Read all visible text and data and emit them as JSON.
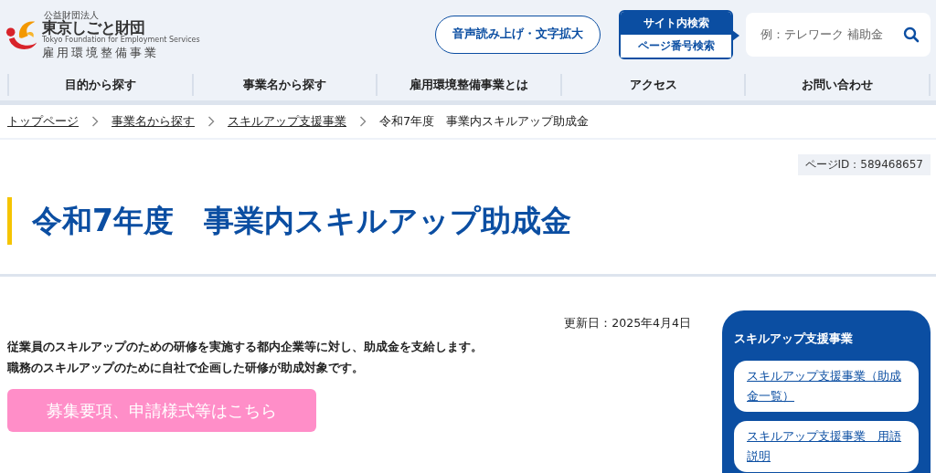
{
  "logo": {
    "org_type": "公益財団法人",
    "name": "東京しごと財団",
    "english": "Tokyo Foundation for Employment Services",
    "division": "雇用環境整備事業"
  },
  "accessibility_button": "音声読み上げ・文字拡大",
  "search_tabs": [
    {
      "label": "サイト内検索",
      "selected": true
    },
    {
      "label": "ページ番号検索",
      "selected": false
    }
  ],
  "search": {
    "placeholder": "例：テレワーク 補助金"
  },
  "nav": [
    "目的から探す",
    "事業名から探す",
    "雇用環境整備事業とは",
    "アクセス",
    "お問い合わせ"
  ],
  "breadcrumb": [
    {
      "label": "トップページ",
      "link": true
    },
    {
      "label": "事業名から探す",
      "link": true
    },
    {
      "label": "スキルアップ支援事業",
      "link": true
    },
    {
      "label": "令和7年度　事業内スキルアップ助成金",
      "link": false
    }
  ],
  "page_id": "ページID：589468657",
  "title": "令和7年度　事業内スキルアップ助成金",
  "updated": "更新日：2025年4月4日",
  "intro": [
    "従業員のスキルアップのための研修を実施する都内企業等に対し、助成金を支給します。",
    "職務のスキルアップのために自社で企画した研修が助成対象です。"
  ],
  "cta_button": "募集要項、申請様式等はこちら",
  "sidebar": {
    "title": "スキルアップ支援事業",
    "links": [
      "スキルアップ支援事業（助成金一覧）",
      "スキルアップ支援事業　用語説明"
    ]
  }
}
